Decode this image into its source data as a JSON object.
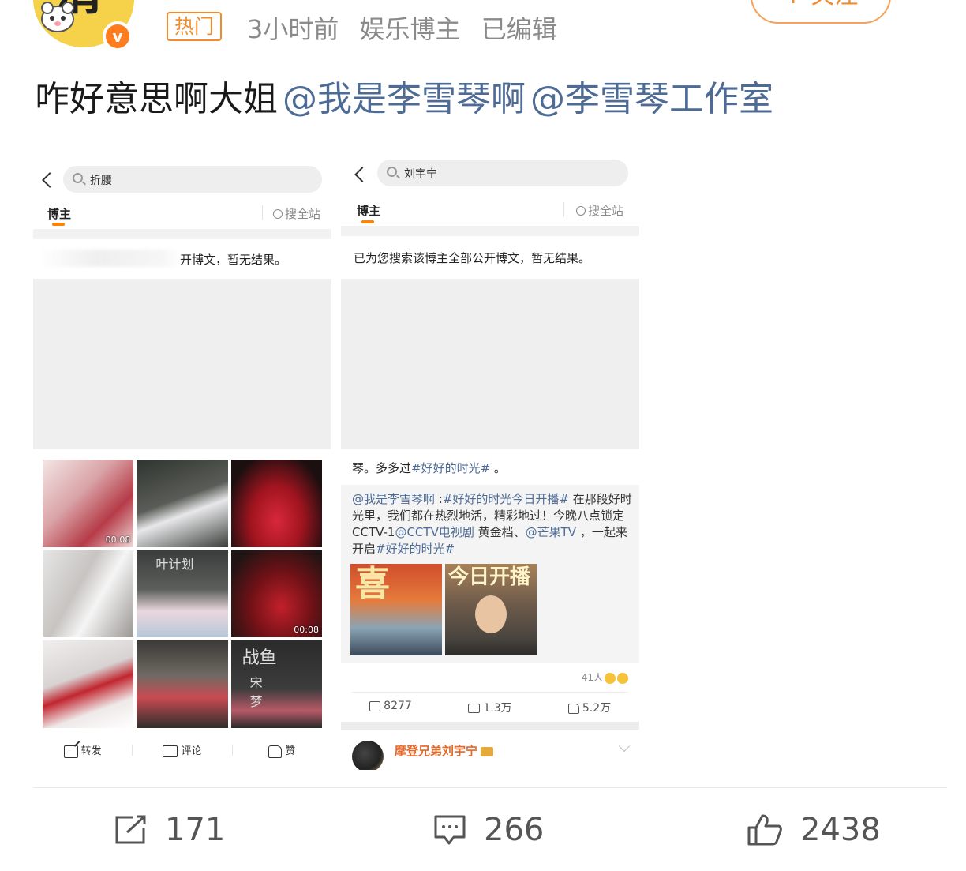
{
  "author": {
    "avatar_glyph": "滑",
    "verified_badge": "v",
    "hot_tag": "热门",
    "time": "3小时前",
    "category": "娱乐博主",
    "edited": "已编辑",
    "follow_label": "+ 关注"
  },
  "post": {
    "text": "咋好意思啊大姐",
    "mentions": [
      "@我是李雪琴啊",
      "@李雪琴工作室"
    ]
  },
  "left_screenshot": {
    "search_query": "折腰",
    "tab_label": "博主",
    "site_search": "搜全站",
    "result_msg": "开博文，暂无结果。",
    "video_durations": [
      "00:08",
      "00:08"
    ],
    "photo_text": [
      "叶计划",
      "战鱼",
      "宋",
      "梦"
    ],
    "actions": {
      "repost": "转发",
      "comment": "评论",
      "like": "赞"
    }
  },
  "right_screenshot": {
    "search_query": "刘宇宁",
    "tab_label": "博主",
    "site_search": "搜全站",
    "result_msg": "已为您搜索该博主全部公开博文，暂无结果。",
    "post_prefix": "琴。多多过",
    "post_topic": "#好好的时光#",
    "post_suffix": " 。",
    "quote": {
      "mention": "@我是李雪琴啊",
      "sep": " :",
      "topic1": "#好好的时光今日开播#",
      "body1": " 在那段好时光里，我们都在热烈地活，精彩地过！今晚八点锁定CCTV-1",
      "mention2": "@CCTV电视剧",
      "body2": " 黄金档、",
      "mention3": "@芒果TV",
      "body3": " ，一起来开启",
      "topic2": "#好好的时光#"
    },
    "image_text": [
      "喜",
      "今日开播"
    ],
    "reactions_count": "41人",
    "stats": {
      "repost": "8277",
      "comment": "1.3万",
      "like": "5.2万"
    },
    "next_user": "摩登兄弟刘宇宁"
  },
  "engagement": {
    "reposts": "171",
    "comments": "266",
    "likes": "2438"
  },
  "colors": {
    "accent_orange": "#f08c30",
    "mention_blue": "#4d6b94",
    "verified_orange": "#ff7c1f"
  },
  "icons": [
    "repost-icon",
    "comment-icon",
    "like-icon",
    "search-icon",
    "back-icon",
    "verified-icon",
    "crown-icon"
  ]
}
